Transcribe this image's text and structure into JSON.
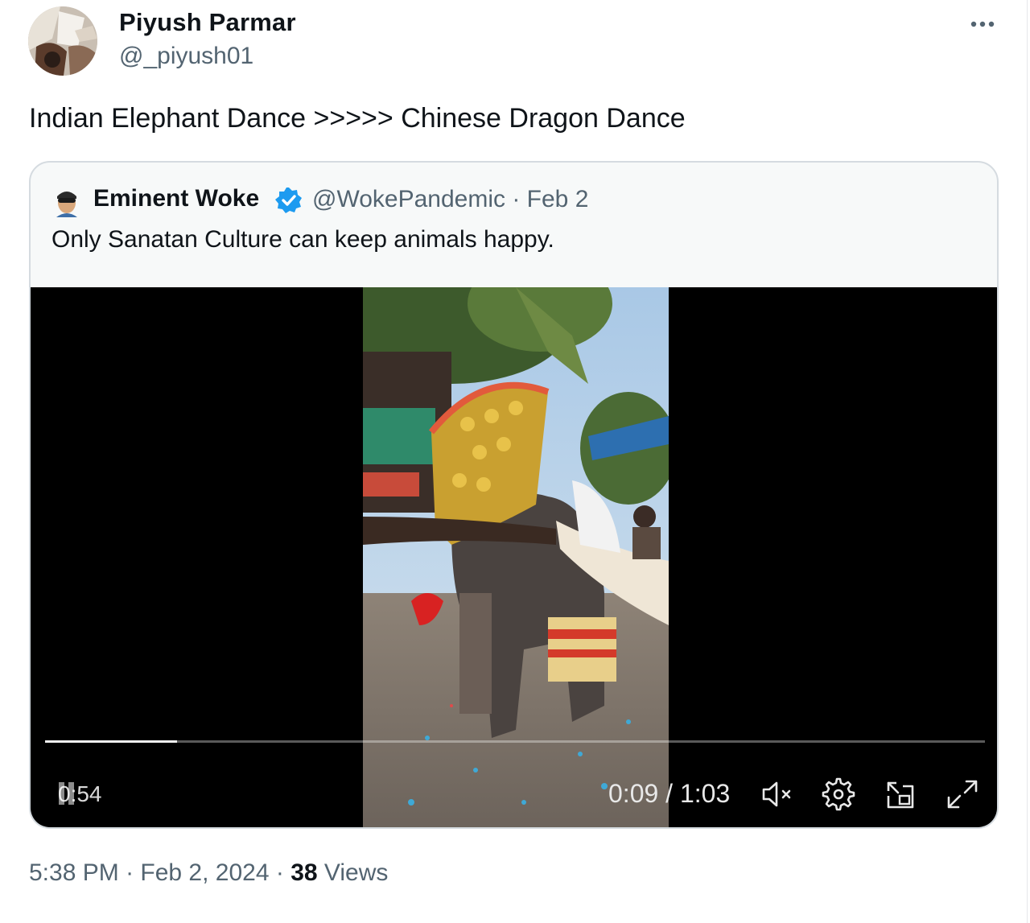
{
  "tweet": {
    "display_name": "Piyush Parmar",
    "handle": "@_piyush01",
    "text": "Indian Elephant Dance >>>>> Chinese Dragon Dance",
    "time": "5:38 PM",
    "date": "Feb 2, 2024",
    "views_count": "38",
    "views_label": "Views",
    "avatar_icon": "profile-photo",
    "more_icon": "more-horizontal-icon"
  },
  "quote": {
    "display_name": "Eminent Woke",
    "verified_icon": "verified-badge-icon",
    "verified_color": "#1d9bf0",
    "handle": "@WokePandemic",
    "date": "Feb 2",
    "text": "Only Sanatan Culture can keep animals happy."
  },
  "video": {
    "remaining": "0:54",
    "current_time": "0:09",
    "duration": "1:03",
    "progress_fraction": 0.14,
    "controls": [
      "mute-icon",
      "settings-gear-icon",
      "picture-in-picture-icon",
      "fullscreen-icon"
    ]
  },
  "colors": {
    "text_primary": "#0f1419",
    "text_secondary": "#536471",
    "card_border": "#d5dbe0",
    "card_bg": "#f7f9f9",
    "video_bg": "#000000"
  }
}
